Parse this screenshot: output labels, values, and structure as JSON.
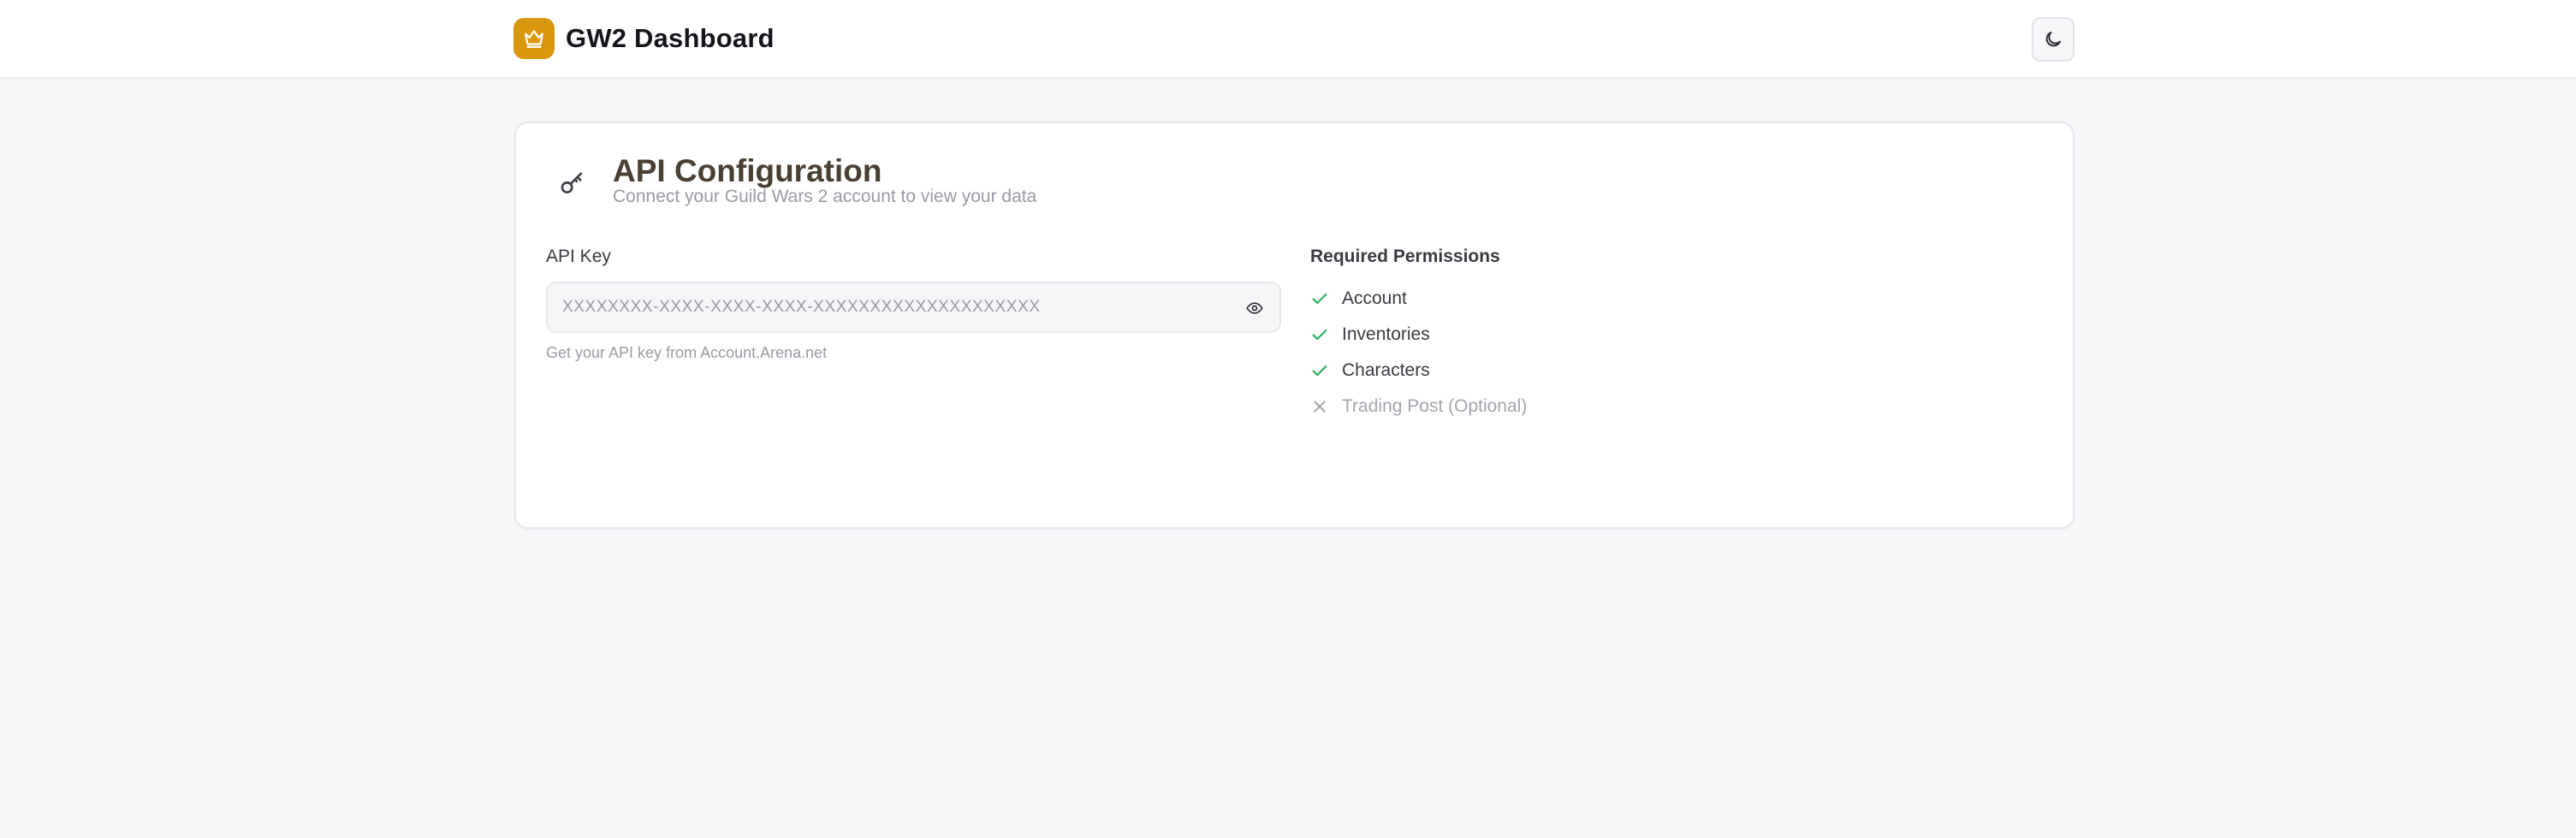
{
  "header": {
    "app_title": "GW2 Dashboard",
    "logo_icon": "crown-icon",
    "theme_toggle_icon": "moon-icon",
    "brand_color": "#d9970f"
  },
  "card": {
    "icon": "key-icon",
    "title": "API Configuration",
    "subtitle": "Connect your Guild Wars 2 account to view your data",
    "api_key": {
      "label": "API Key",
      "value": "",
      "placeholder": "XXXXXXXX-XXXX-XXXX-XXXX-XXXXXXXXXXXXXXXXXXXX",
      "toggle_icon": "eye-icon",
      "hint": "Get your API key from Account.Arena.net"
    },
    "permissions": {
      "title": "Required Permissions",
      "items": [
        {
          "label": "Account",
          "granted": true,
          "icon": "check-icon"
        },
        {
          "label": "Inventories",
          "granted": true,
          "icon": "check-icon"
        },
        {
          "label": "Characters",
          "granted": true,
          "icon": "check-icon"
        },
        {
          "label": "Trading Post (Optional)",
          "granted": false,
          "icon": "x-icon"
        }
      ],
      "granted_color": "#2fb866",
      "missing_color": "#a4a4ad"
    }
  }
}
